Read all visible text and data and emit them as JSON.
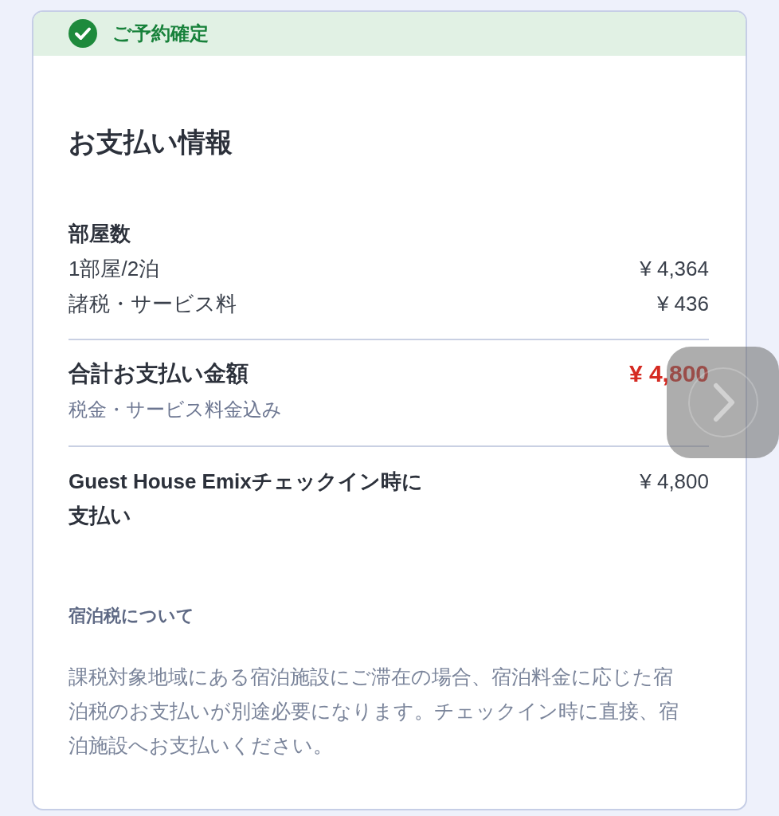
{
  "status_banner": {
    "text": "ご予約確定"
  },
  "payment": {
    "title": "お支払い情報",
    "rooms": {
      "label": "部屋数",
      "lines": [
        {
          "label": "1部屋/2泊",
          "amount": "¥ 4,364"
        },
        {
          "label": "諸税・サービス料",
          "amount": "¥ 436"
        }
      ]
    },
    "total": {
      "label": "合計お支払い金額",
      "amount": "¥ 4,800",
      "note": "税金・サービス料金込み"
    },
    "pay_at_property": {
      "label": "Guest House Emixチェックイン時に支払い",
      "amount": "¥ 4,800"
    }
  },
  "tax_info": {
    "title": "宿泊税について",
    "body": "課税対象地域にある宿泊施設にご滞在の場合、宿泊料金に応じた宿泊税のお支払いが別途必要になります。チェックイン時に直接、宿泊施設へお支払いください。"
  }
}
